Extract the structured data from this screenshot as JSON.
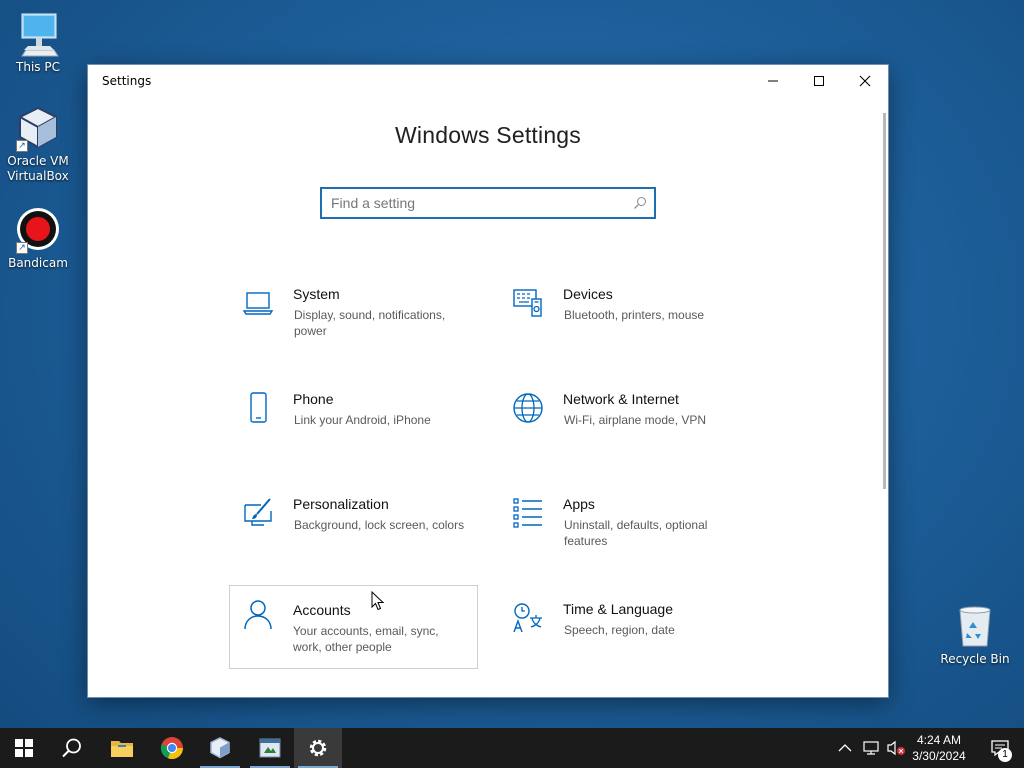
{
  "desktop": {
    "icons": [
      {
        "label": "This PC"
      },
      {
        "label": "Oracle VM VirtualBox"
      },
      {
        "label": "Bandicam"
      },
      {
        "label": "Recycle Bin"
      }
    ]
  },
  "window": {
    "title": "Settings",
    "controls": {
      "minimize": "minimize",
      "maximize": "maximize",
      "close": "close"
    }
  },
  "settings": {
    "heading": "Windows Settings",
    "search_placeholder": "Find a setting",
    "tiles": [
      {
        "name": "System",
        "desc": "Display, sound, notifications, power",
        "icon": "laptop-icon"
      },
      {
        "name": "Devices",
        "desc": "Bluetooth, printers, mouse",
        "icon": "devices-icon"
      },
      {
        "name": "Phone",
        "desc": "Link your Android, iPhone",
        "icon": "phone-icon"
      },
      {
        "name": "Network & Internet",
        "desc": "Wi-Fi, airplane mode, VPN",
        "icon": "globe-icon"
      },
      {
        "name": "Personalization",
        "desc": "Background, lock screen, colors",
        "icon": "paint-icon"
      },
      {
        "name": "Apps",
        "desc": "Uninstall, defaults, optional features",
        "icon": "apps-list-icon"
      },
      {
        "name": "Accounts",
        "desc": "Your accounts, email, sync, work, other people",
        "icon": "person-icon"
      },
      {
        "name": "Time & Language",
        "desc": "Speech, region, date",
        "icon": "time-language-icon"
      }
    ]
  },
  "taskbar": {
    "clock_time": "4:24 AM",
    "clock_date": "3/30/2024",
    "notification_count": "1"
  },
  "colors": {
    "accent": "#0067c0",
    "search_border": "#1f6fb0",
    "taskbar": "#1b1b1b"
  }
}
